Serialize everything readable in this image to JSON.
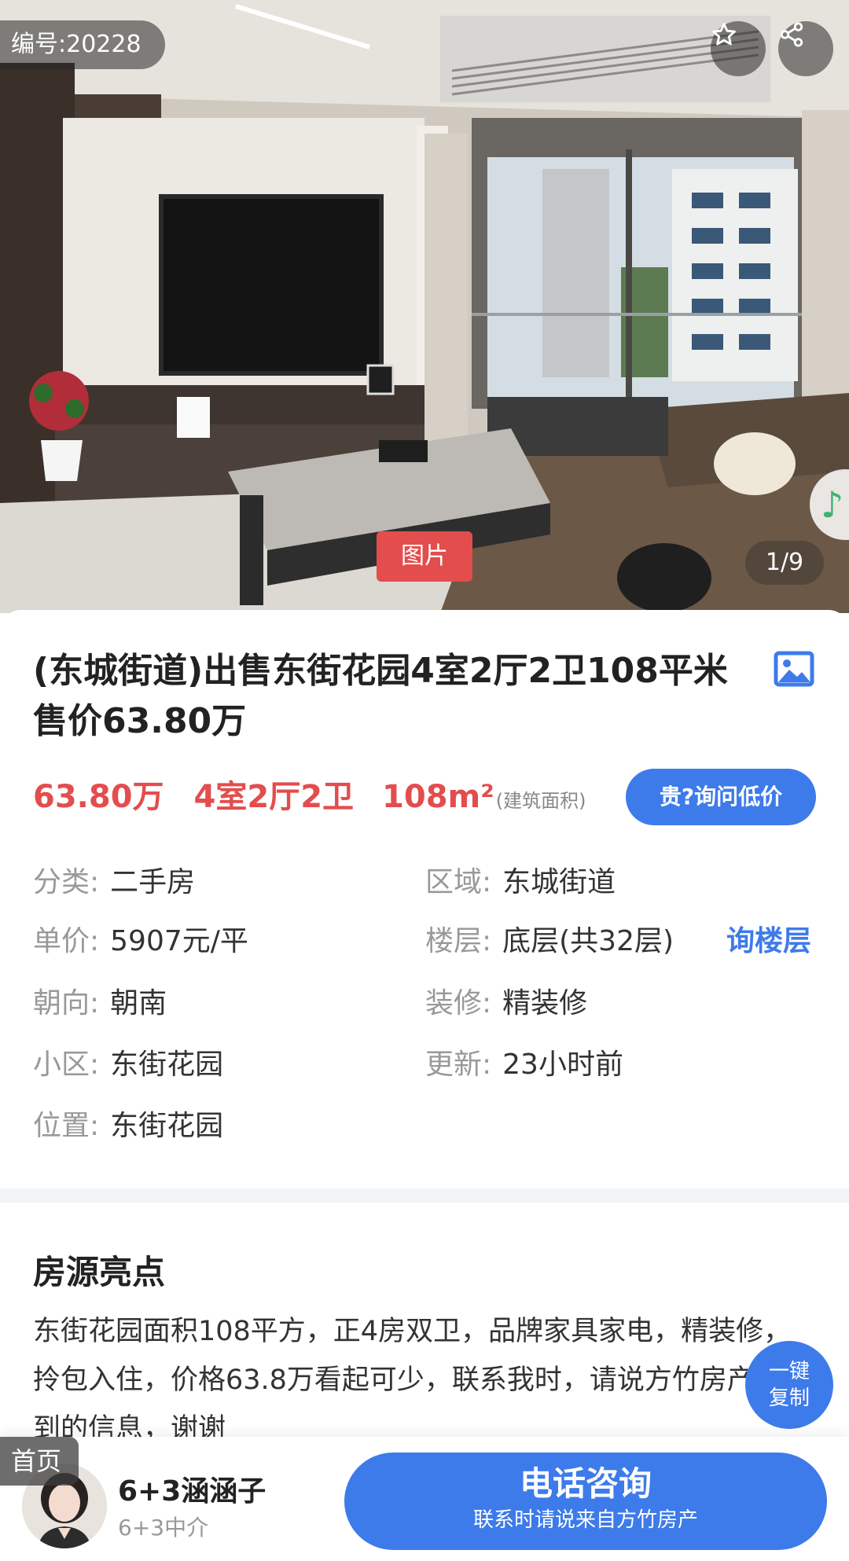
{
  "hero": {
    "listing_id": "编号:20228",
    "image_tab_label": "图片",
    "image_counter": "1/9",
    "icons": {
      "favorite": "star-outline-icon",
      "share": "share-icon",
      "music": "music-note-icon"
    }
  },
  "listing": {
    "title": "(东城街道)出售东街花园4室2厅2卫108平米 售价63.80万",
    "price": "63.80万",
    "rooms": "4室2厅2卫",
    "area": "108",
    "area_unit": "m²",
    "area_note": "(建筑面积)",
    "ask_low_price_button": "贵?询问低价"
  },
  "details": {
    "category": {
      "key": "分类:",
      "value": "二手房"
    },
    "district": {
      "key": "区域:",
      "value": "东城街道"
    },
    "unit_price": {
      "key": "单价:",
      "value": "5907元/平"
    },
    "floor": {
      "key": "楼层:",
      "value": "底层(共32层)"
    },
    "ask_floor_link": "询楼层",
    "orientation": {
      "key": "朝向:",
      "value": "朝南"
    },
    "decoration": {
      "key": "装修:",
      "value": "精装修"
    },
    "community": {
      "key": "小区:",
      "value": "东街花园"
    },
    "updated": {
      "key": "更新:",
      "value": "23小时前"
    },
    "location": {
      "key": "位置:",
      "value": "东街花园"
    }
  },
  "highlights": {
    "title": "房源亮点",
    "body": "东街花园面积108平方，正4房双卫，品牌家具家电，精装修，拎包入住，价格63.8万看起可少，联系我时，请说方竹房产看到的信息，谢谢"
  },
  "copy_button": {
    "line1": "一键",
    "line2": "复制"
  },
  "bottom": {
    "home_tab": "首页",
    "agent_name": "6+3涵涵子",
    "agent_company": "6+3中介",
    "call_button": "电话咨询",
    "call_sub": "联系时请说来自方竹房产"
  },
  "colors": {
    "accent_blue": "#3e7bea",
    "price_red": "#e34d4d"
  }
}
